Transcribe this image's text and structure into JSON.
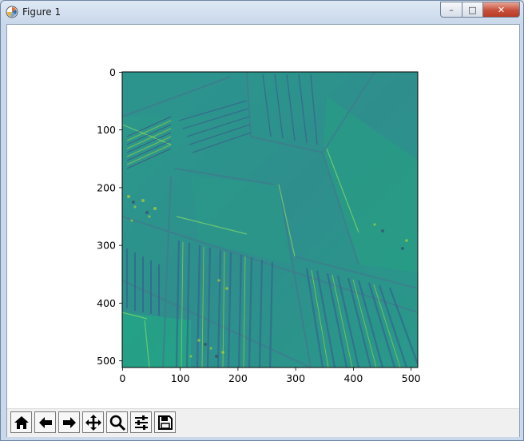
{
  "window": {
    "title": "Figure 1",
    "minimize_glyph": "–",
    "maximize_glyph": "□",
    "close_glyph": "✕"
  },
  "toolbar": {
    "buttons": [
      {
        "name": "home-button",
        "icon": "home-icon"
      },
      {
        "name": "back-button",
        "icon": "arrow-left-icon"
      },
      {
        "name": "forward-button",
        "icon": "arrow-right-icon"
      },
      {
        "name": "pan-button",
        "icon": "move-icon"
      },
      {
        "name": "zoom-button",
        "icon": "magnifier-icon"
      },
      {
        "name": "subplots-button",
        "icon": "sliders-icon"
      },
      {
        "name": "save-button",
        "icon": "floppy-disk-icon"
      }
    ]
  },
  "figure": {
    "image_description_colormap": "viridis",
    "x_ticks": [
      "0",
      "100",
      "200",
      "300",
      "400",
      "500"
    ],
    "y_ticks": [
      "0",
      "100",
      "200",
      "300",
      "400",
      "500"
    ],
    "x_range": [
      0,
      511
    ],
    "y_range": [
      0,
      511
    ]
  }
}
